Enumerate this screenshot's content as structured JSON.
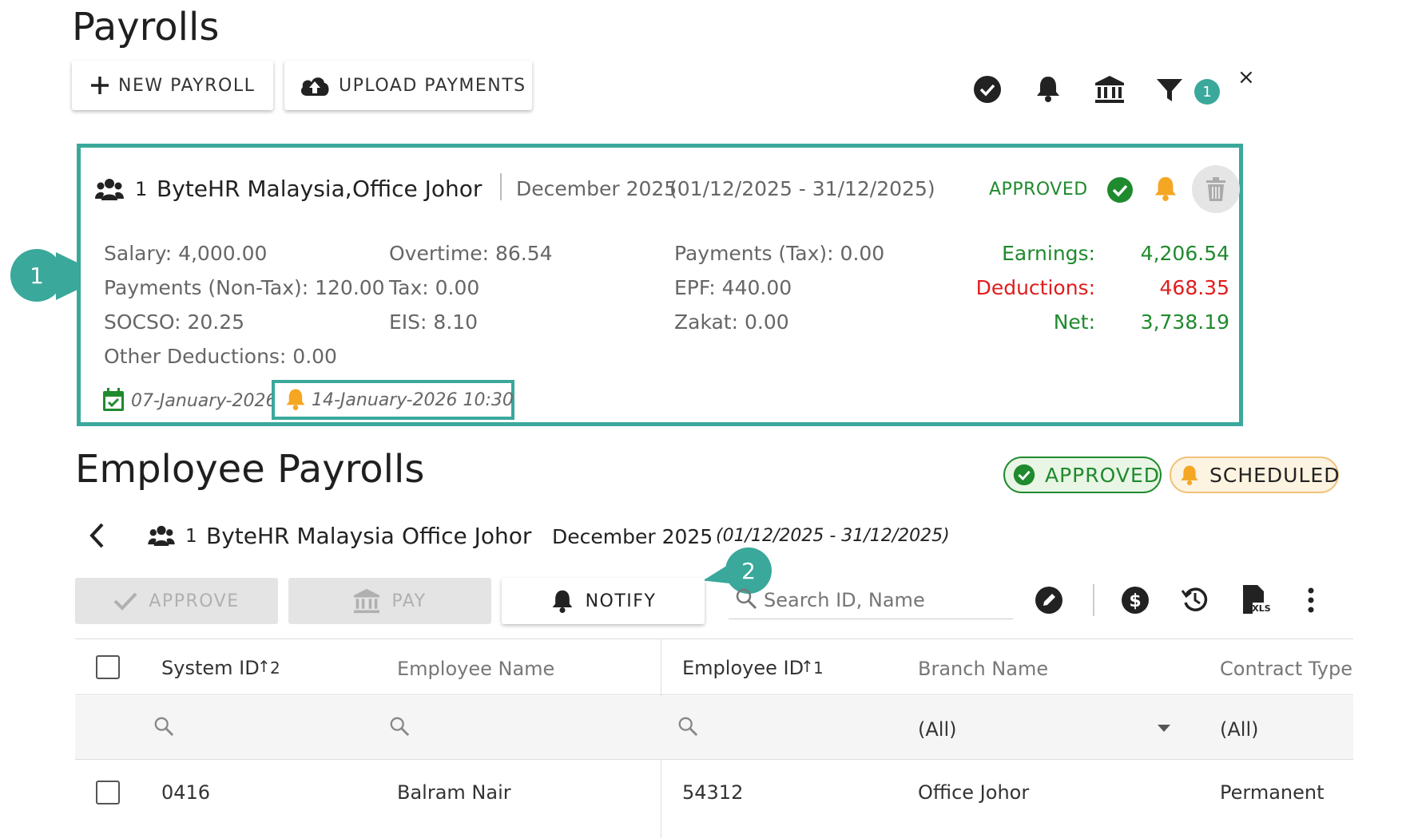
{
  "page_title": "Payrolls",
  "toolbar": {
    "new_payroll": "NEW PAYROLL",
    "upload_payments": "UPLOAD PAYMENTS",
    "filter_count": "1",
    "close": "×"
  },
  "payroll_card": {
    "employee_count": "1",
    "company": "ByteHR Malaysia,",
    "branch": "Office Johor",
    "period": "December 2025",
    "period_range": "(01/12/2025 - 31/12/2025)",
    "status": "APPROVED",
    "details": {
      "salary": "Salary: 4,000.00",
      "payments_non_tax": "Payments (Non-Tax): 120.00",
      "socso": "SOCSO: 20.25",
      "other_deductions": "Other Deductions: 0.00",
      "overtime": "Overtime: 86.54",
      "tax": "Tax: 0.00",
      "eis": "EIS: 8.10",
      "payments_tax": "Payments (Tax): 0.00",
      "epf": "EPF: 440.00",
      "zakat": "Zakat: 0.00"
    },
    "totals": {
      "earnings_label": "Earnings:",
      "earnings_value": "4,206.54",
      "deductions_label": "Deductions:",
      "deductions_value": "468.35",
      "net_label": "Net:",
      "net_value": "3,738.19"
    },
    "pay_date": "07-January-2026",
    "notify_datetime": "14-January-2026 10:30"
  },
  "callouts": [
    "1",
    "2"
  ],
  "employee_section": {
    "title": "Employee Payrolls",
    "badges": {
      "approved": "APPROVED",
      "scheduled": "SCHEDULED"
    },
    "breadcrumb": {
      "employee_count": "1",
      "company": "ByteHR Malaysia",
      "branch": "Office Johor",
      "period": "December 2025",
      "period_range": "(01/12/2025 - 31/12/2025)"
    },
    "actions": {
      "approve": "APPROVE",
      "pay": "PAY",
      "notify": "NOTIFY",
      "search_placeholder": "Search ID, Name"
    }
  },
  "table": {
    "columns": [
      {
        "label": "System ID",
        "sort": "2"
      },
      {
        "label": "Employee Name"
      },
      {
        "label": "Employee ID",
        "sort": "1"
      },
      {
        "label": "Branch Name"
      },
      {
        "label": "Contract Type"
      }
    ],
    "filters": {
      "branch": "(All)",
      "contract": "(All)"
    },
    "rows": [
      {
        "system_id": "0416",
        "employee_name": "Balram Nair",
        "employee_id": "54312",
        "branch_name": "Office Johor",
        "contract_type": "Permanent"
      }
    ]
  },
  "colors": {
    "accent_teal": "#3aa89b",
    "approved_green": "#1f8a2e",
    "deductions_red": "#e11d1d",
    "bell_amber": "#f5a623"
  }
}
